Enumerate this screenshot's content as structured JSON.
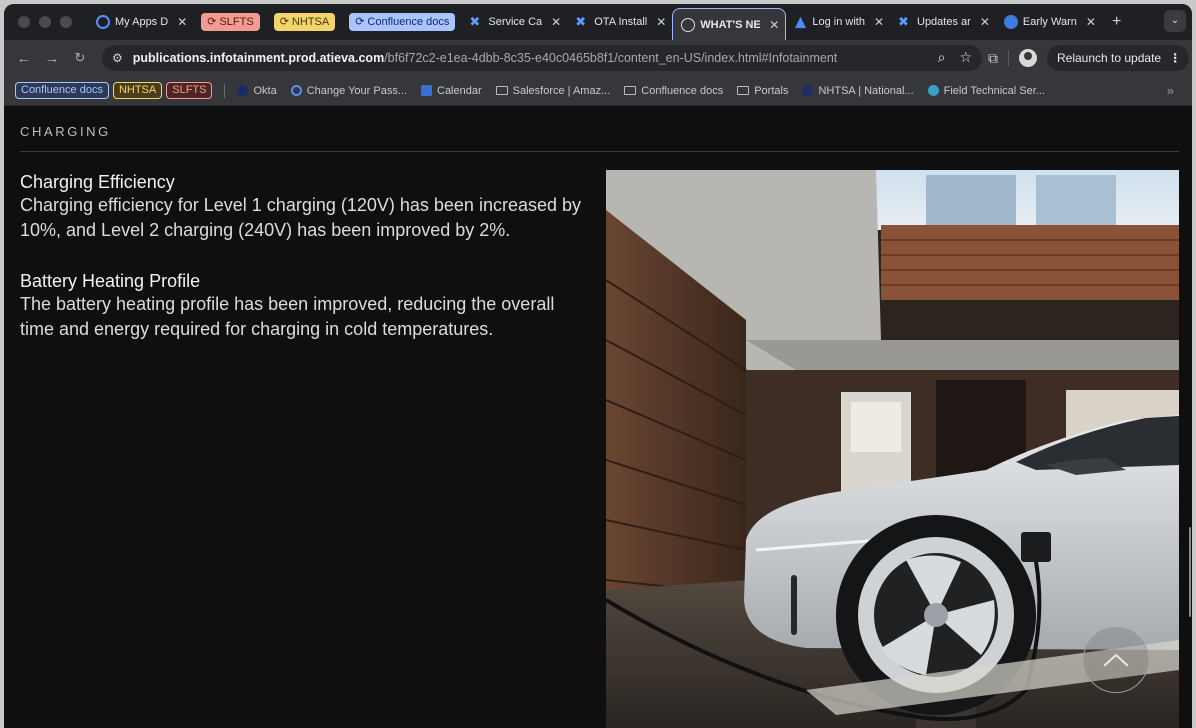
{
  "tabs": [
    {
      "title": "My Apps D",
      "chip": null,
      "icon": "okta-ring-icon"
    },
    {
      "title": "SLFTS",
      "chip": "red",
      "icon": "refresh-icon"
    },
    {
      "title": "NHTSA",
      "chip": "yellow",
      "icon": "refresh-icon"
    },
    {
      "title": "Confluence docs",
      "chip": "blue",
      "icon": "refresh-icon"
    },
    {
      "title": "Service Ca",
      "chip": null,
      "icon": "confluence-icon"
    },
    {
      "title": "OTA Install",
      "chip": null,
      "icon": "confluence-icon"
    },
    {
      "title": "WHAT'S NE",
      "chip": null,
      "icon": "globe-icon",
      "active": true
    },
    {
      "title": "Log in with",
      "chip": null,
      "icon": "atlassian-icon"
    },
    {
      "title": "Updates ar",
      "chip": null,
      "icon": "confluence-icon"
    },
    {
      "title": "Early Warn",
      "chip": null,
      "icon": "early-warning-icon"
    }
  ],
  "toolbar": {
    "url_host": "publications.infotainment.prod.atieva.com",
    "url_path": "/bf6f72c2-e1ea-4dbb-8c35-e40c0465b8f1/content_en-US/index.html#Infotainment",
    "relaunch_label": "Relaunch to update"
  },
  "bookmarks": {
    "chips": [
      {
        "label": "Confluence docs",
        "color": "blue"
      },
      {
        "label": "NHTSA",
        "color": "yellow"
      },
      {
        "label": "SLFTS",
        "color": "red"
      }
    ],
    "items": [
      {
        "label": "Okta",
        "icon": "okta-dot-icon"
      },
      {
        "label": "Change Your Pass...",
        "icon": "okta-ring-icon"
      },
      {
        "label": "Calendar",
        "icon": "calendar-icon"
      },
      {
        "label": "Salesforce | Amaz...",
        "icon": "folder-icon"
      },
      {
        "label": "Confluence docs",
        "icon": "folder-icon"
      },
      {
        "label": "Portals",
        "icon": "folder-icon"
      },
      {
        "label": "NHTSA | National...",
        "icon": "nhtsa-icon"
      },
      {
        "label": "Field Technical Ser...",
        "icon": "field-tech-icon"
      }
    ]
  },
  "page": {
    "section_label": "CHARGING",
    "features": [
      {
        "title": "Charging Efficiency",
        "body": "Charging efficiency for Level 1 charging (120V) has been increased by 10%, and Level 2 charging (240V) has been improved by 2%."
      },
      {
        "title": "Battery Heating Profile",
        "body": "The battery heating profile has been improved, reducing the overall time and energy required for charging in cold temperatures."
      }
    ]
  },
  "colors": {
    "page_bg": "#0f0f0f",
    "tab_bar": "#1f2023",
    "toolbar": "#36373b",
    "chip_red": "#f29b92",
    "chip_yellow": "#f3d36b",
    "chip_blue": "#a9c4ff"
  }
}
